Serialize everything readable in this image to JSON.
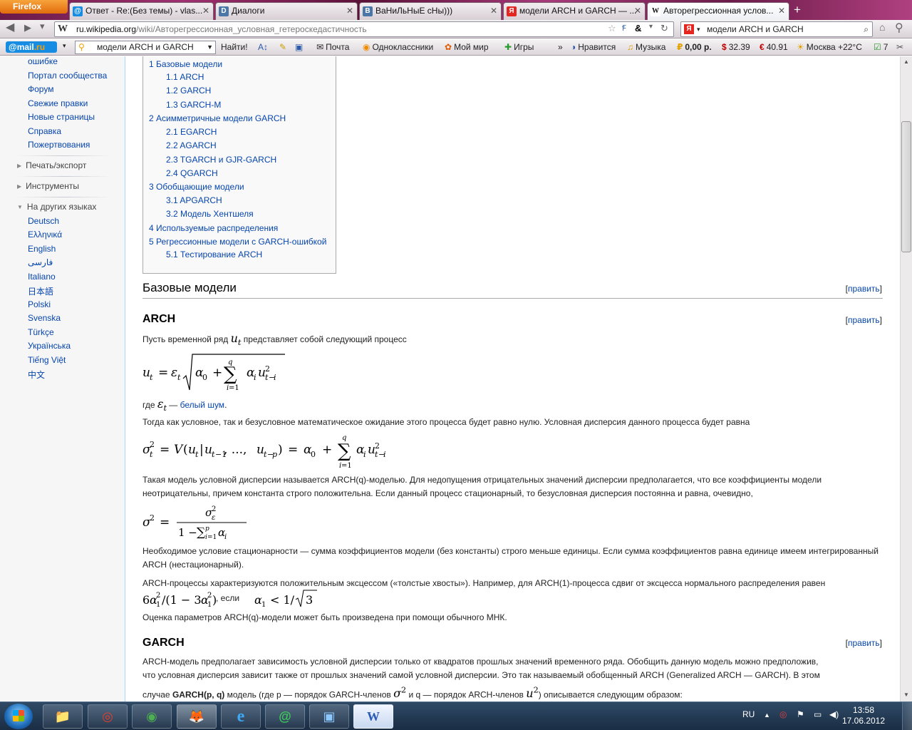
{
  "browser": {
    "app_button": "Firefox",
    "tabs": [
      {
        "label": "Ответ - Re:(Без темы) - vlas...",
        "icon": "@"
      },
      {
        "label": "Диалоги",
        "icon": "D"
      },
      {
        "label": "ВаНиЛьНыЕ сНы)))",
        "icon": "B"
      },
      {
        "label": "модели ARCH и GARCH — ...",
        "icon": "Я"
      },
      {
        "label": "Авторегрессионная услов...",
        "icon": "W"
      }
    ],
    "new_tab": "+",
    "url_domain": "ru.wikipedia.org",
    "url_path": "/wiki/Авторегрессионная_условная_гетероскедастичность",
    "search_engine_icon": "Я",
    "search_value": "модели ARCH и GARCH"
  },
  "mailbar": {
    "logo_main": "@mail",
    "logo_suffix": ".ru",
    "search_value": "модели ARCH и GARCH",
    "find_button": "Найти!",
    "items": [
      {
        "label": "Почта",
        "icon": "✉"
      },
      {
        "label": "Одноклассники",
        "icon": "◉"
      },
      {
        "label": "Мой мир",
        "icon": "✿"
      },
      {
        "label": "Игры",
        "icon": "✚"
      },
      {
        "label": "»",
        "icon": ""
      },
      {
        "label": "Нравится",
        "icon": "◑"
      },
      {
        "label": "Музыка",
        "icon": "♫"
      },
      {
        "label": "0,00 р.",
        "icon": "₽"
      },
      {
        "label": "32.39",
        "icon": "$"
      },
      {
        "label": "40.91",
        "icon": "€"
      },
      {
        "label": "Москва +22°C",
        "icon": "☀"
      },
      {
        "label": "7",
        "icon": "☑"
      }
    ]
  },
  "sidebar": {
    "links_top": [
      "ошибке",
      "Портал сообщества",
      "Форум",
      "Свежие правки",
      "Новые страницы",
      "Справка",
      "Пожертвования"
    ],
    "sections": [
      "Печать/экспорт",
      "Инструменты",
      "На других языках"
    ],
    "languages": [
      "Deutsch",
      "Ελληνικά",
      "English",
      "فارسی",
      "Italiano",
      "日本語",
      "Polski",
      "Svenska",
      "Türkçe",
      "Українська",
      "Tiếng Việt",
      "中文"
    ]
  },
  "toc": [
    {
      "text": "1 Базовые модели",
      "level": 1
    },
    {
      "text": "1.1 ARCH",
      "level": 2
    },
    {
      "text": "1.2 GARCH",
      "level": 2
    },
    {
      "text": "1.3 GARCH-M",
      "level": 2
    },
    {
      "text": "2 Асимметричные модели GARCH",
      "level": 1
    },
    {
      "text": "2.1 EGARCH",
      "level": 2
    },
    {
      "text": "2.2 AGARCH",
      "level": 2
    },
    {
      "text": "2.3 TGARCH и GJR-GARCH",
      "level": 2
    },
    {
      "text": "2.4 QGARCH",
      "level": 2
    },
    {
      "text": "3 Обобщающие модели",
      "level": 1
    },
    {
      "text": "3.1 APGARCH",
      "level": 2
    },
    {
      "text": "3.2 Модель Хентшеля",
      "level": 2
    },
    {
      "text": "4 Используемые распределения",
      "level": 1
    },
    {
      "text": "5 Регрессионные модели с GARCH-ошибкой",
      "level": 1
    },
    {
      "text": "5.1 Тестирование ARCH",
      "level": 2
    }
  ],
  "article": {
    "edit_open": "[",
    "edit_label": "править",
    "edit_close": "]",
    "h2_basic": "Базовые модели",
    "h3_arch": "ARCH",
    "p1_pre": "Пусть временной ряд",
    "p1_post": "представляет собой следующий процесс",
    "p2_pre": "где",
    "p2_dash": "—",
    "p2_link": "белый шум",
    "p2_end": ".",
    "p3": "Тогда как условное, так и безусловное математическое ожидание этого процесса будет равно нулю. Условная дисперсия данного процесса будет равна",
    "p4": "Такая модель условной дисперсии называется ARCH(q)-моделью. Для недопущения отрицательных значений дисперсии предполагается, что все коэффициенты модели неотрицательны, причем константа строго положительна. Если данный процесс стационарный, то безусловная дисперсия постоянна и равна, очевидно,",
    "p5": "Необходимое условие стационарности — сумма коэффициентов модели (без константы) строго меньше единицы. Если сумма коэффициентов равна единице имеем интегрированный ARCH (нестационарный).",
    "p6": "ARCH-процессы характеризуются положительным эксцессом («толстые хвосты»). Например, для ARCH(1)-процесса сдвиг от эксцесса нормального распределения равен",
    "p6_mid": ", если",
    "p7": "Оценка параметров ARCH(q)-модели может быть произведена при помощи обычного МНК.",
    "h3_garch": "GARCH",
    "p8_1": "ARCH-модель предполагает зависимость условной дисперсии только от квадратов прошлых значений временного ряда. Обобщить данную модель можно предположив,",
    "p8_2": "что условная дисперсия зависит также от прошлых значений самой условной дисперсии. Это так называемый обобщенный ARCH (Generalized ARCH — GARCH). В этом",
    "p8_3a": "случае",
    "p8_3b": "GARCH(p, q)",
    "p8_3c": "модель (где p — порядок GARCH-членов",
    "p8_3d": "и q — порядок ARCH-членов",
    "p8_3e": ") описывается следующим образом:"
  },
  "taskbar": {
    "apps": [
      "📁",
      "◎",
      "◉",
      "🦊",
      "e",
      "@",
      "▣",
      "W"
    ],
    "lang": "RU",
    "time": "13:58",
    "date": "17.06.2012"
  }
}
